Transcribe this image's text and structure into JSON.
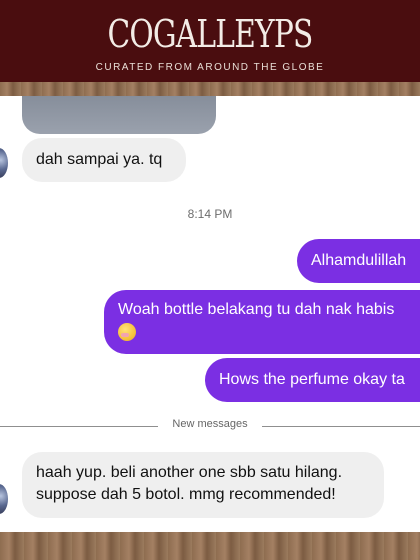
{
  "brand": {
    "name": "COGALLEYPS",
    "tagline": "CURATED FROM AROUND THE GLOBE"
  },
  "chat": {
    "messages_before": [
      {
        "direction": "incoming",
        "text": "dah sampai ya. tq"
      }
    ],
    "timestamp": "8:14 PM",
    "messages_after": [
      {
        "direction": "outgoing",
        "text": "Alhamdulillah"
      },
      {
        "direction": "outgoing",
        "text": "Woah bottle belakang tu dah nak habis",
        "emoji": "face-with-hand-over-mouth"
      },
      {
        "direction": "outgoing",
        "text": "Hows the perfume okay ta"
      }
    ],
    "new_messages_label": "New messages",
    "messages_new": [
      {
        "direction": "incoming",
        "line1": "haah yup. beli another one sbb satu hilang.",
        "line2": "suppose dah 5 botol. mmg recommended!"
      }
    ]
  },
  "colors": {
    "outgoing_bubble": "#7b2fe3",
    "incoming_bubble": "#efefef",
    "banner": "#4a0d0f"
  }
}
